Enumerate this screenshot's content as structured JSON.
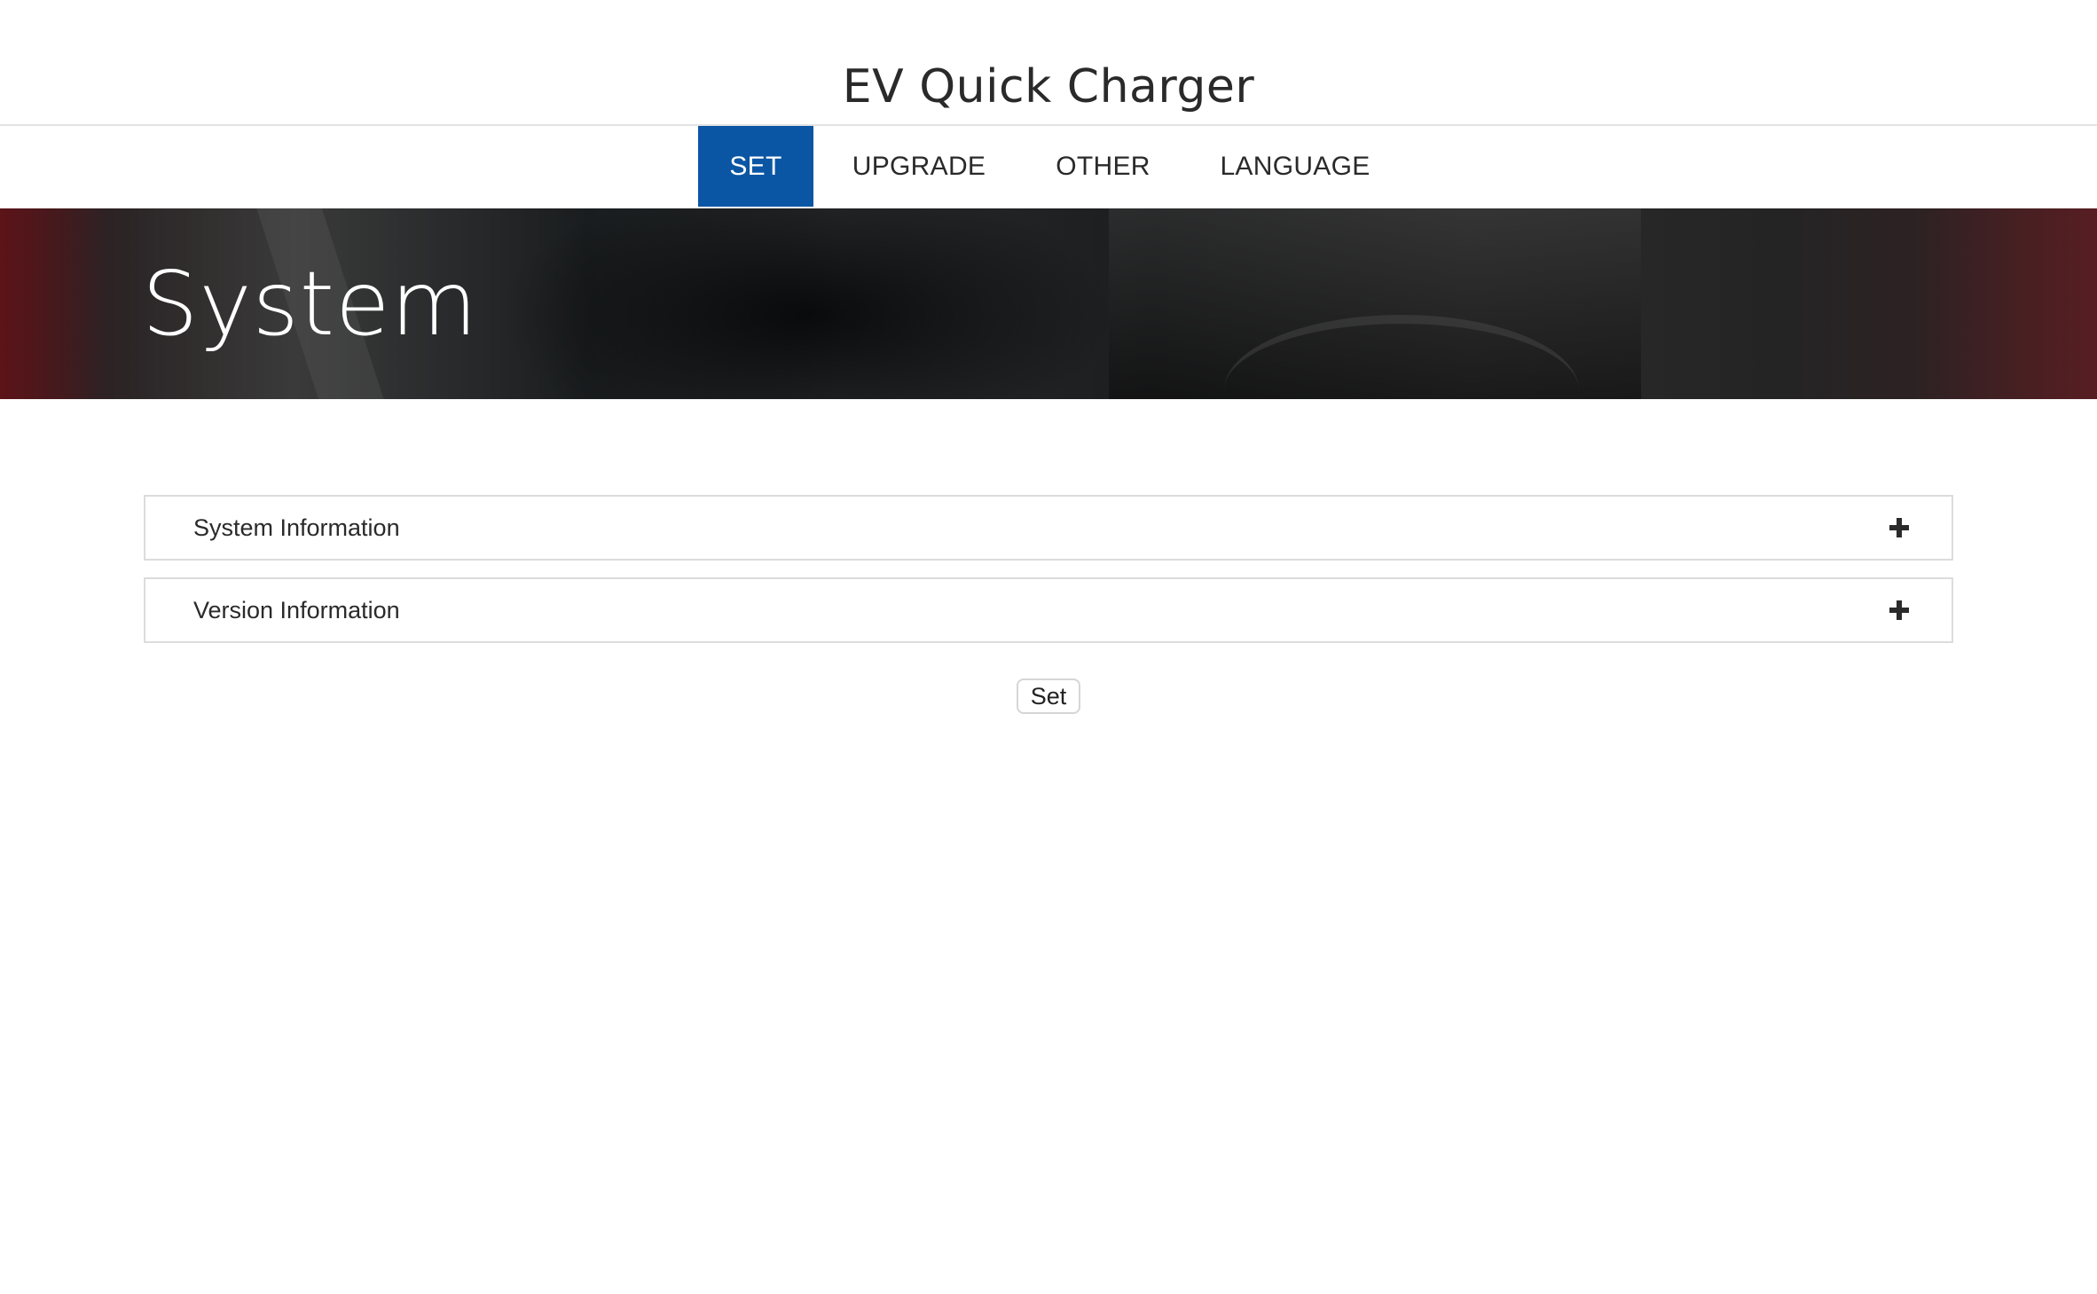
{
  "header": {
    "title": "EV Quick Charger"
  },
  "nav": {
    "items": [
      {
        "label": "SET",
        "active": true
      },
      {
        "label": "UPGRADE",
        "active": false
      },
      {
        "label": "OTHER",
        "active": false
      },
      {
        "label": "LANGUAGE",
        "active": false
      }
    ],
    "active_color": "#0a56a4"
  },
  "banner": {
    "title": "System"
  },
  "panels": [
    {
      "label": "System Information",
      "icon": "plus-icon",
      "expanded": false
    },
    {
      "label": "Version Information",
      "icon": "plus-icon",
      "expanded": false
    }
  ],
  "actions": {
    "set_label": "Set"
  }
}
